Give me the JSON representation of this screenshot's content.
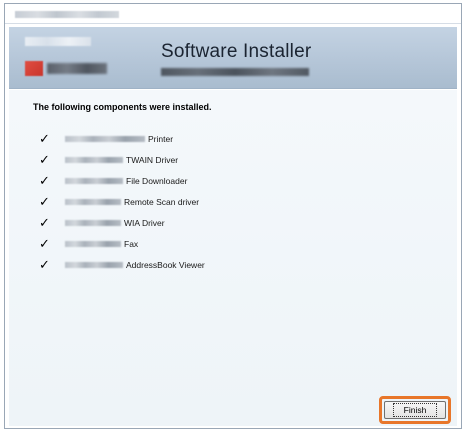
{
  "header": {
    "title": "Software Installer"
  },
  "content": {
    "heading": "The following components were installed.",
    "components": [
      {
        "label": "Printer",
        "blur_width": 80
      },
      {
        "label": "TWAIN Driver",
        "blur_width": 58
      },
      {
        "label": "File Downloader",
        "blur_width": 58
      },
      {
        "label": "Remote Scan driver",
        "blur_width": 56
      },
      {
        "label": "WIA Driver",
        "blur_width": 56
      },
      {
        "label": "Fax",
        "blur_width": 56
      },
      {
        "label": "AddressBook Viewer",
        "blur_width": 58
      }
    ]
  },
  "footer": {
    "finish_label": "Finish"
  },
  "colors": {
    "highlight_ring": "#e8762a",
    "header_top": "#c4d3e3",
    "header_bottom": "#a9bccf",
    "content_bg": "#f4f8fb"
  },
  "icons": {
    "check": "check-icon"
  }
}
